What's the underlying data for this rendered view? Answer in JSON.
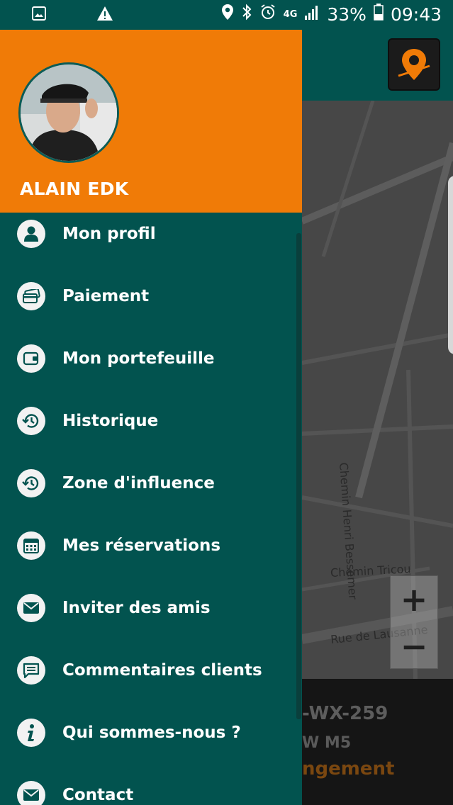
{
  "status_bar": {
    "network": "4G",
    "battery": "33%",
    "time": "09:43"
  },
  "drawer": {
    "username": "ALAIN EDK",
    "menu": [
      {
        "label": "Mon profil",
        "icon": "person-icon"
      },
      {
        "label": "Paiement",
        "icon": "cards-icon"
      },
      {
        "label": "Mon portefeuille",
        "icon": "wallet-icon"
      },
      {
        "label": "Historique",
        "icon": "history-icon"
      },
      {
        "label": "Zone d'influence",
        "icon": "history-icon"
      },
      {
        "label": "Mes réservations",
        "icon": "calendar-icon"
      },
      {
        "label": "Inviter des amis",
        "icon": "mail-icon"
      },
      {
        "label": "Commentaires clients",
        "icon": "comment-icon"
      },
      {
        "label": "Qui sommes-nous ?",
        "icon": "info-icon"
      },
      {
        "label": "Contact",
        "icon": "mail-icon"
      }
    ]
  },
  "map": {
    "street_1": "Chemin Henri Bessemer",
    "street_2": "Chemin Tricou",
    "street_3": "Rue de Lausanne",
    "zoom_in": "+",
    "zoom_out": "−"
  },
  "vehicle_panel": {
    "plate": "-WX-259",
    "model": "W M5",
    "status": "ngement"
  },
  "colors": {
    "primary": "#02534f",
    "accent": "#f07b07",
    "status_text": "#7a4710"
  }
}
